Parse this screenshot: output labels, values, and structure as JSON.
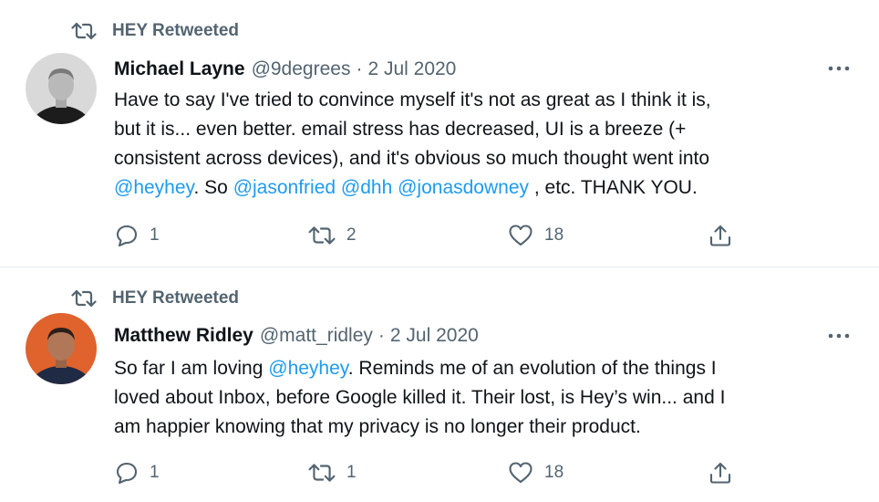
{
  "tweets": [
    {
      "retweeted_by": "HEY Retweeted",
      "author_name": "Michael Layne",
      "author_handle": "@9degrees",
      "separator": "·",
      "date": "2 Jul 2020",
      "lines": [
        [
          {
            "text": "Have to say I've tried to convince myself it's not as great as I think it is,"
          }
        ],
        [
          {
            "text": "but it is... even better. email stress has decreased, UI is a breeze (+"
          }
        ],
        [
          {
            "text": "consistent across devices), and it's obvious so much thought went into"
          }
        ],
        [
          {
            "text": "@heyhey",
            "mention": true
          },
          {
            "text": ". So "
          },
          {
            "text": "@jasonfried",
            "mention": true
          },
          {
            "text": " "
          },
          {
            "text": "@dhh",
            "mention": true
          },
          {
            "text": " "
          },
          {
            "text": "@jonasdowney",
            "mention": true
          },
          {
            "text": " , etc. THANK YOU."
          }
        ]
      ],
      "replies": "1",
      "retweets": "2",
      "likes": "18",
      "more_icon": "ellipsis-icon",
      "avatar_colors": {
        "background": "#d9d9d9",
        "skin": "#b9b9b9",
        "shirt": "#1c1c1c"
      }
    },
    {
      "retweeted_by": "HEY Retweeted",
      "author_name": "Matthew Ridley",
      "author_handle": "@matt_ridley",
      "separator": "·",
      "date": "2 Jul 2020",
      "lines": [
        [
          {
            "text": "So far I am loving "
          },
          {
            "text": "@heyhey",
            "mention": true
          },
          {
            "text": ". Reminds me of an evolution of the things I"
          }
        ],
        [
          {
            "text": "loved about Inbox, before Google killed it. Their lost, is Hey’s win... and I"
          }
        ],
        [
          {
            "text": "am happier knowing that my privacy is no longer their product."
          }
        ]
      ],
      "replies": "1",
      "retweets": "1",
      "likes": "18",
      "more_icon": "ellipsis-icon",
      "avatar_colors": {
        "background": "#e0622c",
        "skin": "#b07858",
        "shirt": "#1f2a44"
      }
    }
  ],
  "icons": {
    "retweet_header": "retweet-icon",
    "reply": "reply-icon",
    "retweet": "retweet-icon",
    "like": "heart-icon",
    "share": "share-icon"
  },
  "colors": {
    "text": "#0f1419",
    "secondary": "#536471",
    "mention": "#1d9bf0",
    "divider": "#e6ecf0"
  }
}
